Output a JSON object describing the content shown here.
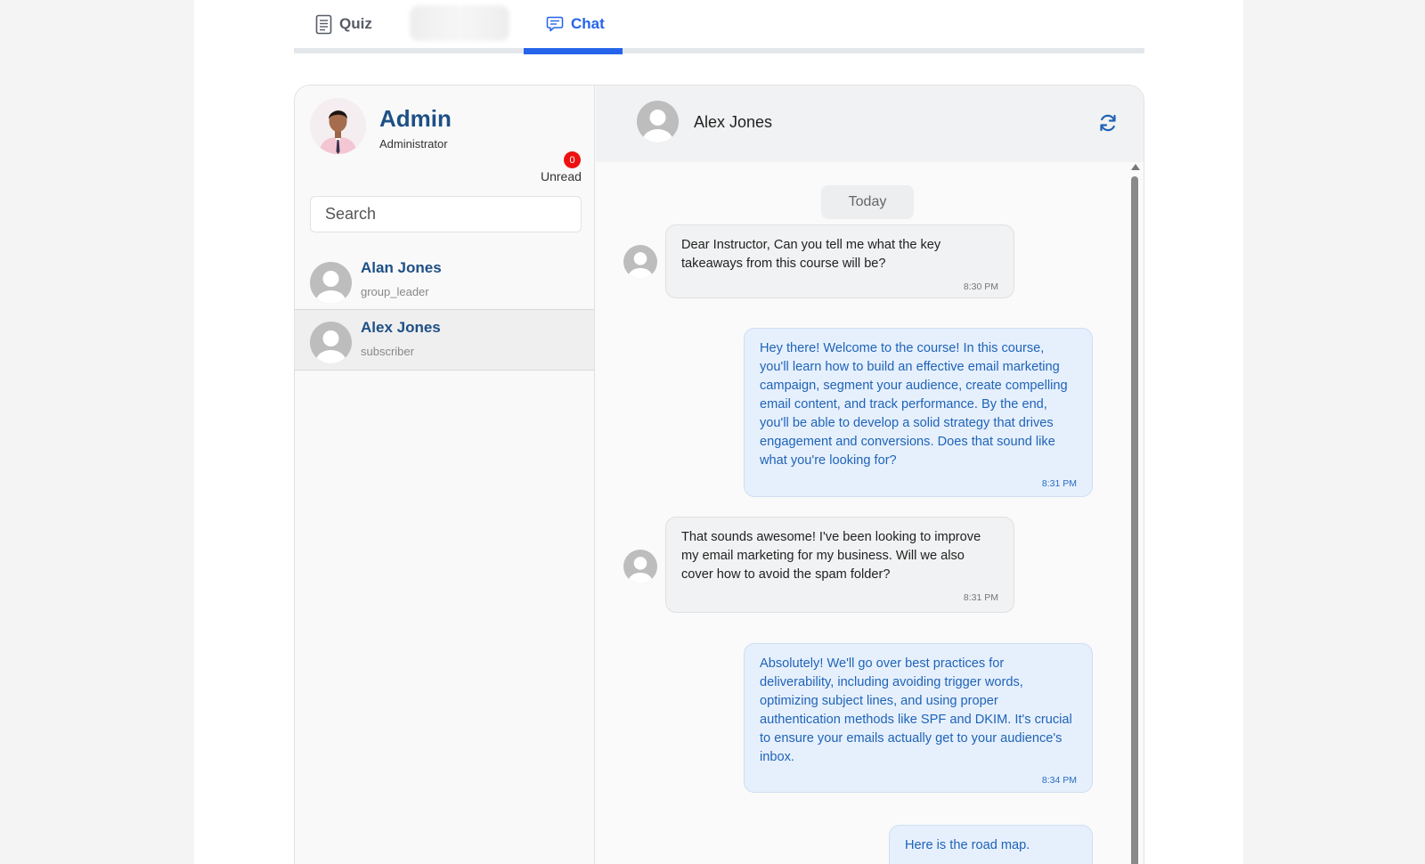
{
  "tabs": [
    {
      "label": "Quiz",
      "icon": "document-icon"
    },
    {
      "label": "",
      "icon": "blurred-tab"
    },
    {
      "label": "Chat",
      "icon": "chat-bubble-icon"
    }
  ],
  "active_tab": "Chat",
  "colors": {
    "accent": "#2563eb",
    "name": "#1e4f86",
    "badge": "#ee1111",
    "outgoing_text": "#1f63b7",
    "outgoing_bg": "#e6f0fd"
  },
  "sidebar": {
    "admin": {
      "name": "Admin",
      "role": "Administrator"
    },
    "unread": {
      "count": "0",
      "label": "Unread"
    },
    "search_placeholder": "Search",
    "contacts": [
      {
        "name": "Alan Jones",
        "role": "group_leader"
      },
      {
        "name": "Alex Jones",
        "role": "subscriber"
      }
    ]
  },
  "conversation": {
    "contact_name": "Alex Jones",
    "day_label": "Today",
    "messages": [
      {
        "direction": "in",
        "text": "Dear Instructor, Can you tell me what the key takeaways from this course will be?",
        "time": "8:30 PM"
      },
      {
        "direction": "out",
        "text": "Hey there! Welcome to the course! In this course, you'll learn how to build an effective email marketing campaign, segment your audience, create compelling email content, and track performance. By the end, you'll be able to develop a solid strategy that drives engagement and conversions. Does that sound like what you're looking for?",
        "time": "8:31 PM"
      },
      {
        "direction": "in",
        "text": "That sounds awesome! I've been looking to improve my email marketing for my business. Will we also cover how to avoid the spam folder?",
        "time": "8:31 PM"
      },
      {
        "direction": "out",
        "text": "Absolutely! We'll go over best practices for deliverability, including avoiding trigger words, optimizing subject lines, and using proper authentication methods like SPF and DKIM. It's crucial to ensure your emails actually get to your audience's inbox.",
        "time": "8:34 PM"
      },
      {
        "direction": "out",
        "text": "Here is the road map.",
        "time": ""
      }
    ]
  }
}
